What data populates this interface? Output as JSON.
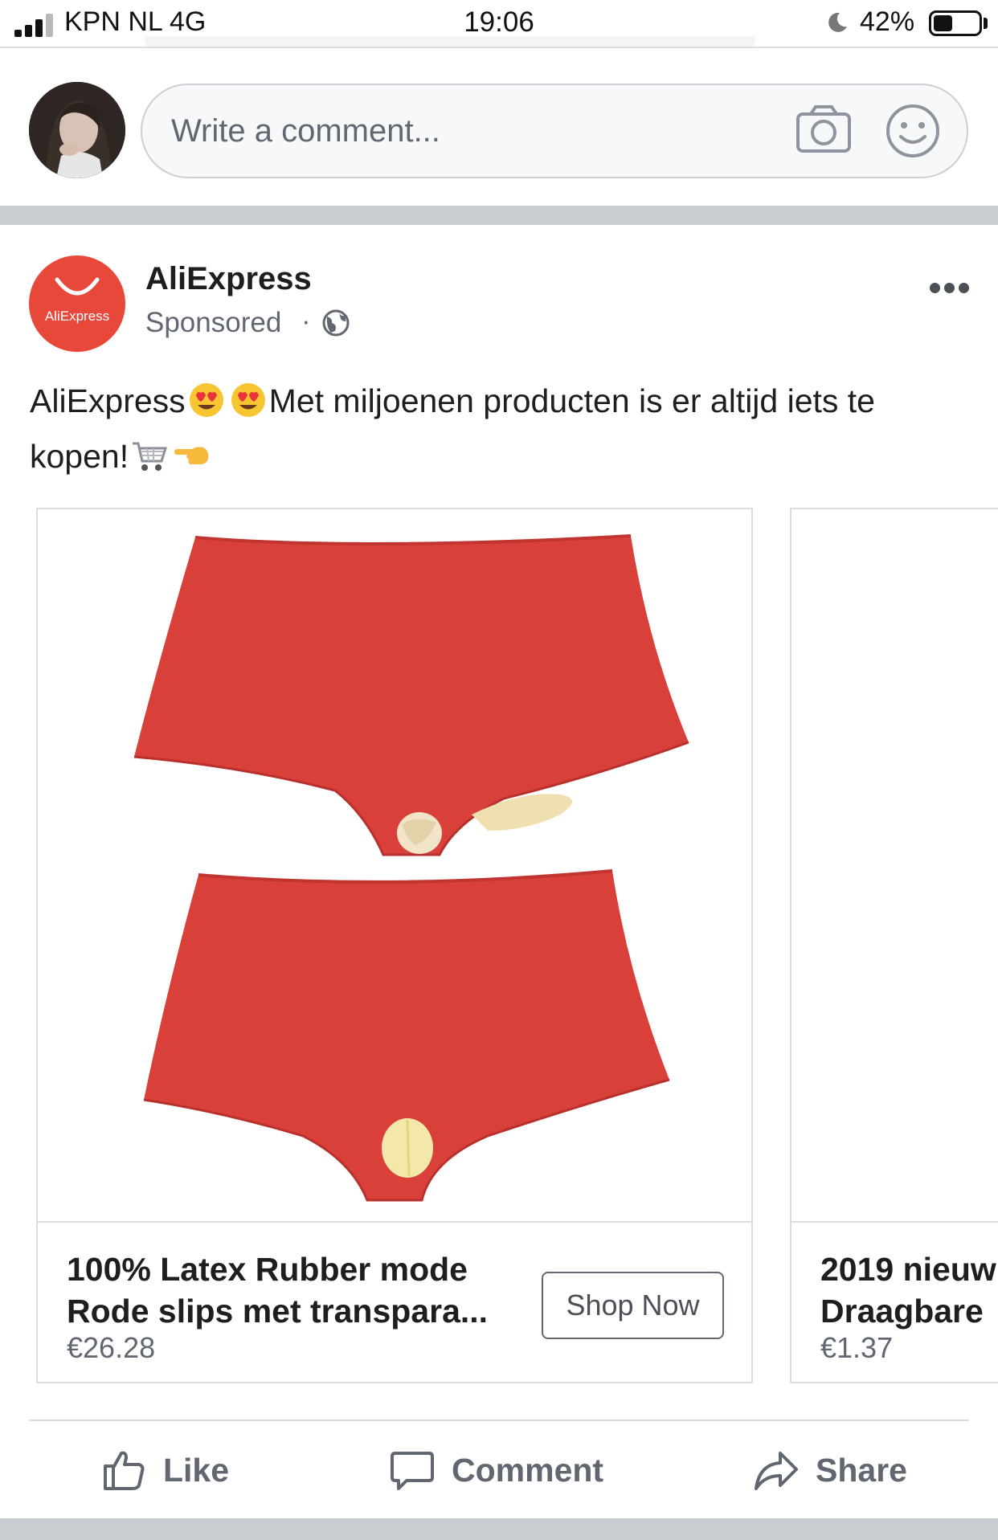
{
  "status_bar": {
    "carrier": "KPN NL  4G",
    "time": "19:06",
    "battery_percent": "42%",
    "battery_level": 0.42,
    "signal_bars_active": 3,
    "icons": [
      "signal-icon",
      "moon-icon",
      "battery-icon"
    ]
  },
  "composer": {
    "placeholder": "Write a comment...",
    "icons": [
      "camera-icon",
      "emoji-icon"
    ]
  },
  "post": {
    "page_name": "AliExpress",
    "avatar_text": "AliExpress",
    "sponsored_label": "Sponsored",
    "separator": "·",
    "privacy_icon": "globe-icon",
    "text_start": "AliExpress",
    "text_middle": "Met miljoenen producten is er altijd iets te kopen!",
    "emojis": [
      "heart-eyes-emoji",
      "heart-eyes-emoji",
      "shopping-cart-emoji",
      "pointing-left-emoji"
    ]
  },
  "carousel": {
    "cards": [
      {
        "title_line1": "100% Latex Rubber mode",
        "title_line2": "Rode slips met transpara...",
        "price": "€26.28",
        "cta": "Shop Now",
        "image": "red-latex-briefs-image"
      },
      {
        "title_line1": "2019 nieuw",
        "title_line2": "Draagbare",
        "price": "€1.37"
      }
    ]
  },
  "actions": {
    "like": "Like",
    "comment": "Comment",
    "share": "Share"
  },
  "colors": {
    "brand_red": "#e8483a",
    "product_red": "#d9403a",
    "text_secondary": "#606770",
    "separator": "#c9ccd1"
  }
}
